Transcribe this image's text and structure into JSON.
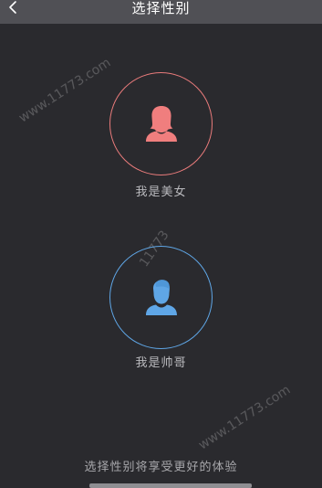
{
  "header": {
    "title": "选择性别",
    "back_icon": "chevron-left-icon"
  },
  "choices": {
    "female": {
      "label": "我是美女",
      "icon": "female-avatar-icon",
      "color": "#f07e7e",
      "ring": "#e97b7b"
    },
    "male": {
      "label": "我是帅哥",
      "icon": "male-avatar-icon",
      "color": "#5fa6e6",
      "ring": "#5fa6e6"
    }
  },
  "hint": "选择性别将享受更好的体验",
  "watermarks": [
    "www.11773.com",
    "11773",
    "www.11773.com"
  ]
}
